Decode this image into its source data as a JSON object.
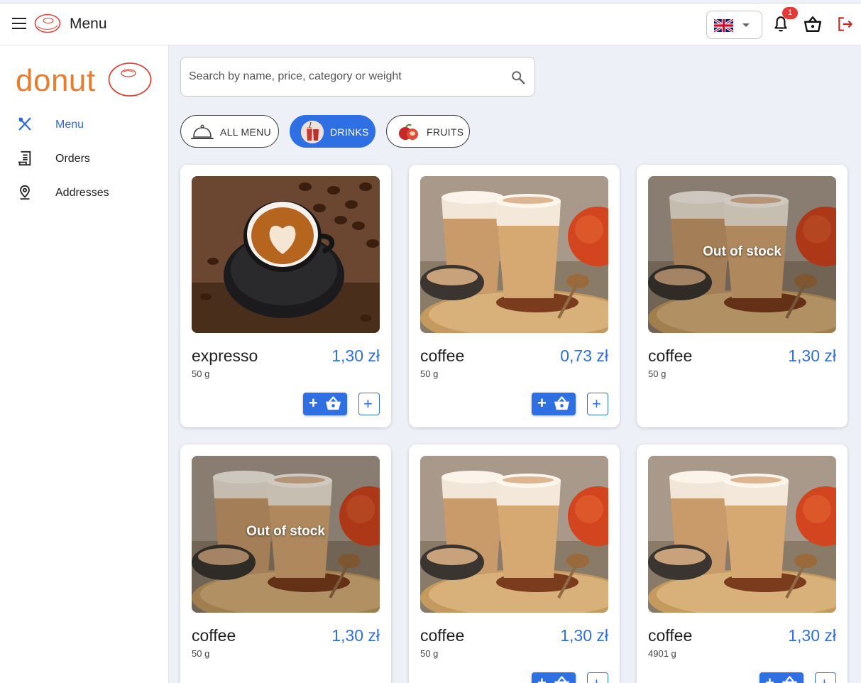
{
  "header": {
    "title": "Menu",
    "language": "EN",
    "notification_count": "1",
    "icons": [
      "menu-icon",
      "donut-logo-icon",
      "uk-flag-icon",
      "bell-icon",
      "basket-icon",
      "logout-icon"
    ],
    "colors": {
      "accent": "#2f6fe4",
      "brand": "#e87d2d",
      "badge": "#e53935",
      "logout": "#c62828"
    }
  },
  "sidebar": {
    "brand": "donut",
    "items": [
      {
        "label": "Menu",
        "icon": "cutlery-icon",
        "active": true
      },
      {
        "label": "Orders",
        "icon": "receipt-icon",
        "active": false
      },
      {
        "label": "Addresses",
        "icon": "location-pin-icon",
        "active": false
      }
    ]
  },
  "search": {
    "placeholder": "Search by name, price, category or weight",
    "value": ""
  },
  "categories": [
    {
      "label": "ALL MENU",
      "icon": "cloche-icon",
      "selected": false
    },
    {
      "label": "DRINKS",
      "icon": "drinks-icon",
      "selected": true
    },
    {
      "label": "FRUITS",
      "icon": "apples-icon",
      "selected": false
    }
  ],
  "products": [
    {
      "name": "expresso",
      "price": "1,30 zł",
      "weight": "50 g",
      "image": "espresso-cup",
      "status": ""
    },
    {
      "name": "coffee",
      "price": "0,73 zł",
      "weight": "50 g",
      "image": "latte-glasses",
      "status": ""
    },
    {
      "name": "coffee",
      "price": "1,30 zł",
      "weight": "50 g",
      "image": "latte-glasses",
      "status": "Out of stock"
    },
    {
      "name": "coffee",
      "price": "1,30 zł",
      "weight": "50 g",
      "image": "latte-glasses",
      "status": "Out of stock"
    },
    {
      "name": "coffee",
      "price": "1,30 zł",
      "weight": "50 g",
      "image": "latte-glasses",
      "status": ""
    },
    {
      "name": "coffee",
      "price": "1,30 zł",
      "weight": "4901 g",
      "image": "latte-glasses",
      "status": ""
    }
  ]
}
